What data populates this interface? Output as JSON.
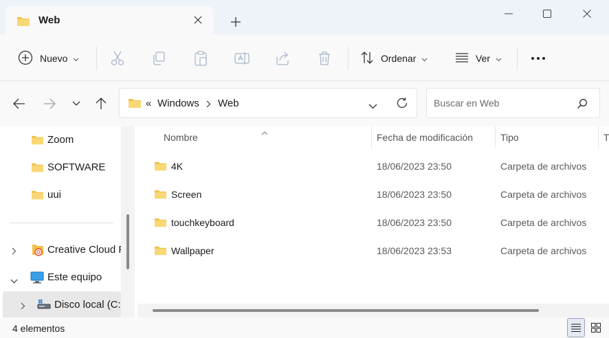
{
  "window": {
    "tab_title": "Web"
  },
  "toolbar": {
    "new_label": "Nuevo",
    "sort_label": "Ordenar",
    "view_label": "Ver"
  },
  "address": {
    "separator": "«",
    "crumbs": [
      "Windows",
      "Web"
    ]
  },
  "search": {
    "placeholder": "Buscar en Web"
  },
  "sidebar": {
    "items": [
      {
        "label": "Zoom",
        "icon": "folder-icon"
      },
      {
        "label": "SOFTWARE",
        "icon": "folder-icon"
      },
      {
        "label": "uui",
        "icon": "folder-icon"
      },
      {
        "label": "Creative Cloud F",
        "icon": "creative-cloud-icon"
      },
      {
        "label": "Este equipo",
        "icon": "pc-icon"
      },
      {
        "label": "Disco local (C:)",
        "icon": "drive-icon"
      }
    ]
  },
  "table": {
    "columns": [
      "Nombre",
      "Fecha de modificación",
      "Tipo",
      "T"
    ],
    "rows": [
      {
        "name": "4K",
        "date": "18/06/2023 23:50",
        "type": "Carpeta de archivos"
      },
      {
        "name": "Screen",
        "date": "18/06/2023 23:50",
        "type": "Carpeta de archivos"
      },
      {
        "name": "touchkeyboard",
        "date": "18/06/2023 23:50",
        "type": "Carpeta de archivos"
      },
      {
        "name": "Wallpaper",
        "date": "18/06/2023 23:53",
        "type": "Carpeta de archivos"
      }
    ]
  },
  "status": {
    "count": "4 elementos"
  },
  "colors": {
    "folder": "#f2c04a",
    "accent": "#005fb8",
    "chrome": "#eef2f9"
  }
}
